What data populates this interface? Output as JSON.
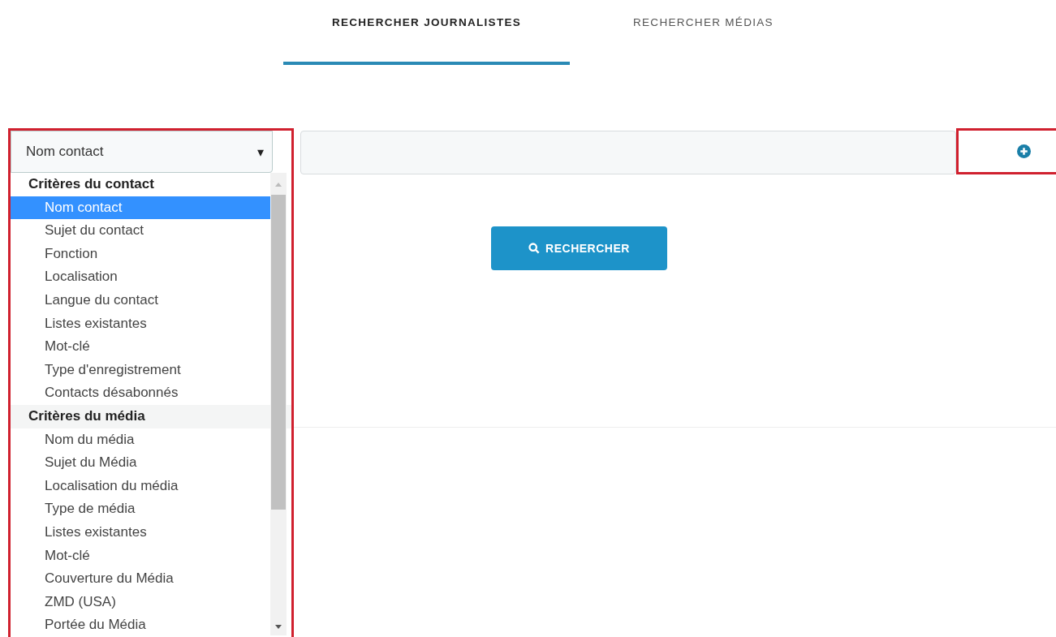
{
  "tabs": [
    {
      "label": "RECHERCHER JOURNALISTES",
      "selected": true
    },
    {
      "label": "RECHERCHER MÉDIAS",
      "selected": false
    }
  ],
  "criteria_select": {
    "value": "Nom contact",
    "caret": "▾",
    "expanded": true
  },
  "dropdown": {
    "groups": [
      {
        "label": "Critères du contact",
        "hovered": false,
        "options": [
          {
            "label": "Nom contact",
            "selected": true
          },
          {
            "label": "Sujet du contact",
            "selected": false
          },
          {
            "label": "Fonction",
            "selected": false
          },
          {
            "label": "Localisation",
            "selected": false
          },
          {
            "label": "Langue du contact",
            "selected": false
          },
          {
            "label": "Listes existantes",
            "selected": false
          },
          {
            "label": "Mot-clé",
            "selected": false
          },
          {
            "label": "Type d'enregistrement",
            "selected": false
          },
          {
            "label": "Contacts désabonnés",
            "selected": false
          }
        ]
      },
      {
        "label": "Critères du média",
        "hovered": true,
        "options": [
          {
            "label": "Nom du média",
            "selected": false
          },
          {
            "label": "Sujet du Média",
            "selected": false
          },
          {
            "label": "Localisation du média",
            "selected": false
          },
          {
            "label": "Type de média",
            "selected": false
          },
          {
            "label": "Listes existantes",
            "selected": false
          },
          {
            "label": "Mot-clé",
            "selected": false
          },
          {
            "label": "Couverture du Média",
            "selected": false
          },
          {
            "label": "ZMD (USA)",
            "selected": false
          },
          {
            "label": "Portée du Média",
            "selected": false
          }
        ]
      }
    ]
  },
  "search_button": {
    "label": "RECHERCHER"
  }
}
